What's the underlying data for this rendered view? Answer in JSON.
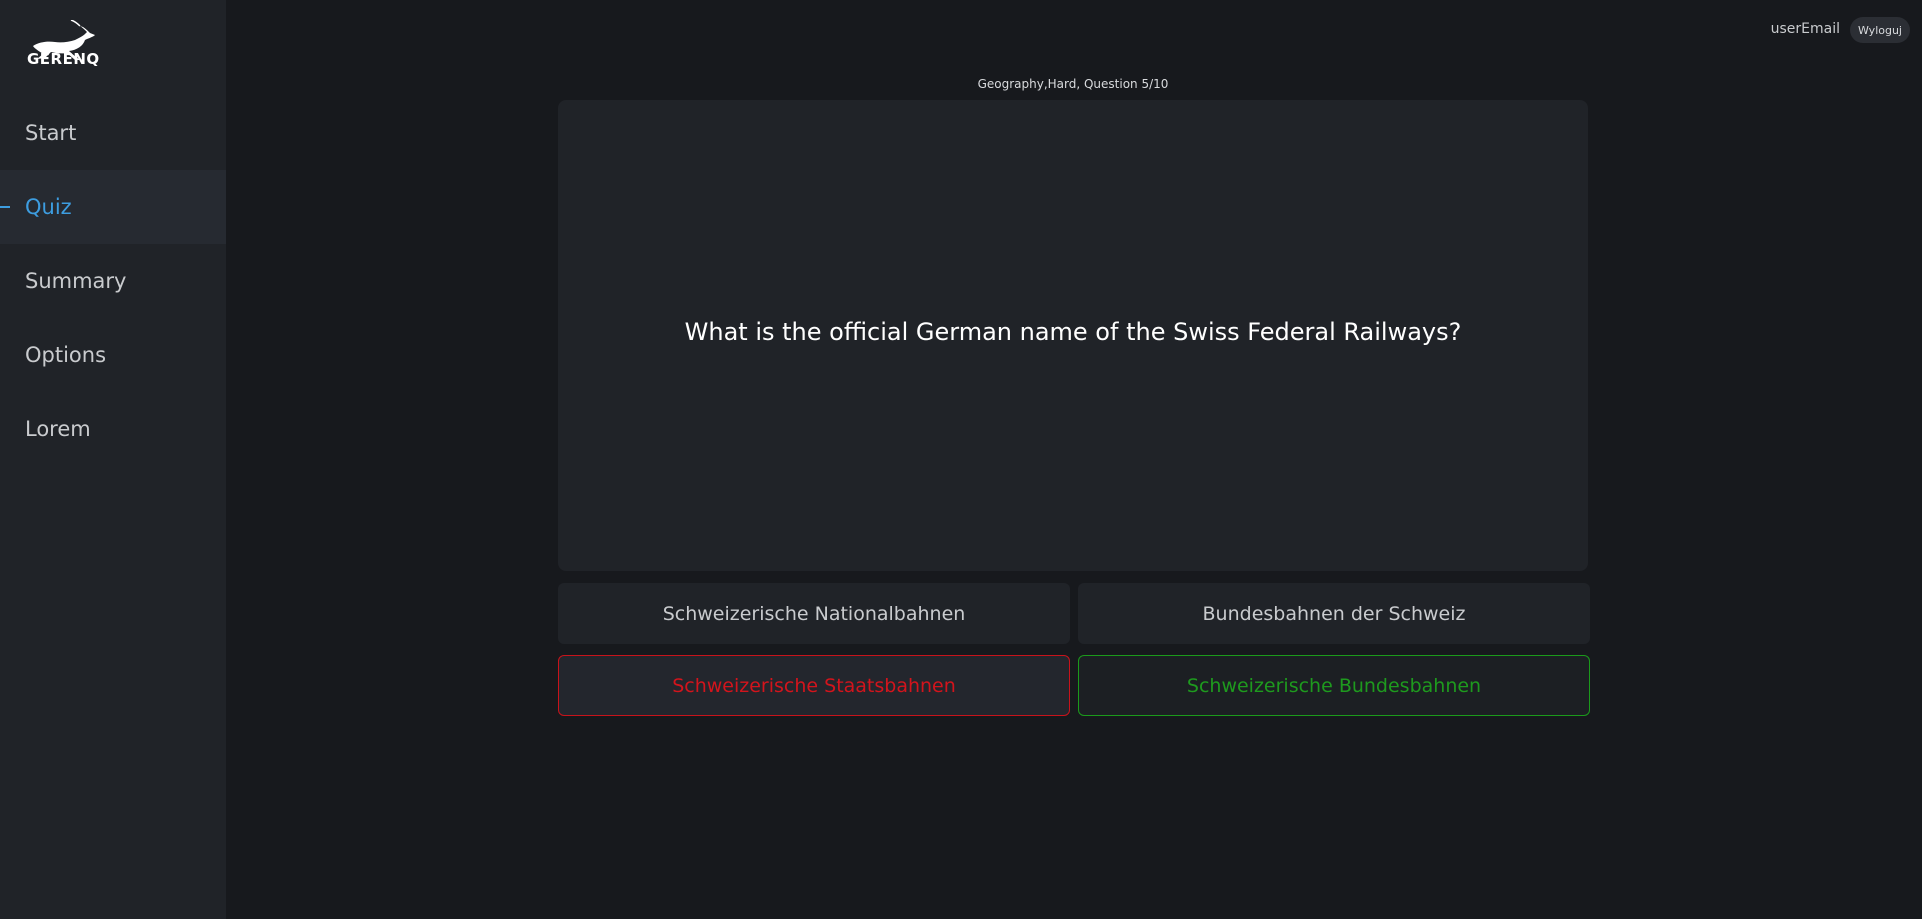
{
  "brand": {
    "logo_text": "GERENQ",
    "logo_icon": "antelope-icon"
  },
  "sidebar": {
    "items": [
      {
        "label": "Start",
        "active": false
      },
      {
        "label": "Quiz",
        "active": true
      },
      {
        "label": "Summary",
        "active": false
      },
      {
        "label": "Options",
        "active": false
      },
      {
        "label": "Lorem",
        "active": false
      }
    ]
  },
  "header": {
    "user_email": "userEmail",
    "logout_label": "Wyloguj"
  },
  "quiz": {
    "meta": "Geography,Hard, Question 5/10",
    "question": "What is the official German name of the Swiss Federal Railways?",
    "answers": [
      {
        "label": "Schweizerische Nationalbahnen",
        "state": "neutral"
      },
      {
        "label": "Bundesbahnen der Schweiz",
        "state": "neutral"
      },
      {
        "label": "Schweizerische Staatsbahnen",
        "state": "wrong"
      },
      {
        "label": "Schweizerische Bundesbahnen",
        "state": "correct"
      }
    ]
  },
  "colors": {
    "accent": "#3d9de0",
    "wrong": "#d3141c",
    "correct": "#1e9a1e",
    "background": "#17191d",
    "sidebar": "#202328"
  }
}
